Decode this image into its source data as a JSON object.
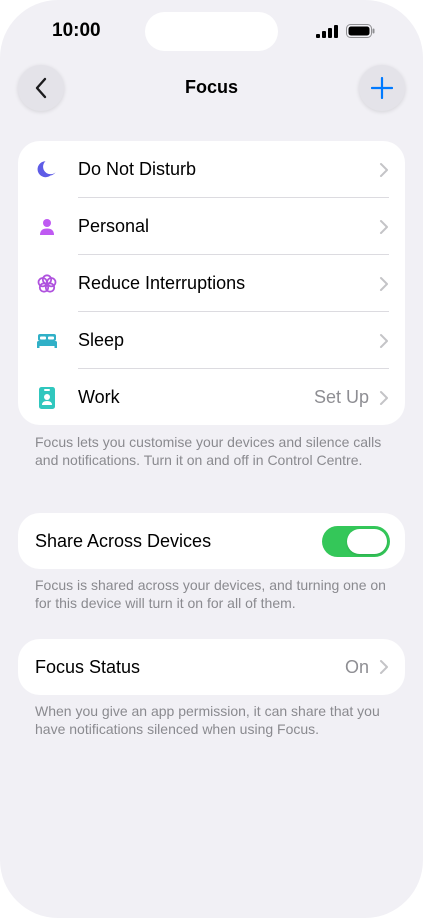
{
  "status_bar": {
    "time": "10:00"
  },
  "nav": {
    "title": "Focus"
  },
  "focus_modes": [
    {
      "label": "Do Not Disturb",
      "icon": "moon-icon",
      "color": "#5e5ce6",
      "value": ""
    },
    {
      "label": "Personal",
      "icon": "person-icon",
      "color": "#bf5af2",
      "value": ""
    },
    {
      "label": "Reduce Interruptions",
      "icon": "flower-icon",
      "color": "#af52de",
      "value": ""
    },
    {
      "label": "Sleep",
      "icon": "bed-icon",
      "color": "#30b0c7",
      "value": ""
    },
    {
      "label": "Work",
      "icon": "id-badge-icon",
      "color": "#30c7be",
      "value": "Set Up"
    }
  ],
  "focus_footnote": "Focus lets you customise your devices and silence calls and notifications. Turn it on and off in Control Centre.",
  "share": {
    "label": "Share Across Devices",
    "enabled": true,
    "toggle_color": "#34c759",
    "footnote": "Focus is shared across your devices, and turning one on for this device will turn it on for all of them."
  },
  "focus_status": {
    "label": "Focus Status",
    "value": "On",
    "footnote": "When you give an app permission, it can share that you have notifications silenced when using Focus."
  },
  "colors": {
    "background": "#f1f0f5",
    "accent": "#007aff",
    "secondary_text": "#8e8e93"
  }
}
